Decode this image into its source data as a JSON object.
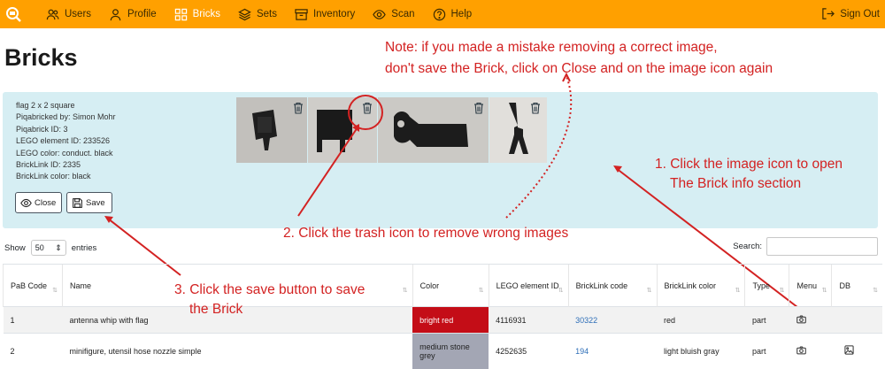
{
  "nav": {
    "items": [
      {
        "label": "Users",
        "icon": "users-icon"
      },
      {
        "label": "Profile",
        "icon": "person-icon"
      },
      {
        "label": "Bricks",
        "icon": "grid-icon"
      },
      {
        "label": "Sets",
        "icon": "layers-icon"
      },
      {
        "label": "Inventory",
        "icon": "archive-icon"
      },
      {
        "label": "Scan",
        "icon": "eye-icon"
      },
      {
        "label": "Help",
        "icon": "question-icon"
      }
    ],
    "active": "Bricks",
    "signout": "Sign Out"
  },
  "page": {
    "title": "Bricks"
  },
  "note": {
    "line1": "Note: if you made a mistake removing a correct image,",
    "line2": "don't save the Brick, click on Close and on the image icon again"
  },
  "info": {
    "lines": [
      "flag 2 x 2 square",
      "Piqabricked by: Simon Mohr",
      "Piqabrick ID: 3",
      "LEGO element ID: 233526",
      "LEGO color: conduct. black",
      "BrickLink ID: 2335",
      "BrickLink color: black"
    ],
    "close_label": "Close",
    "save_label": "Save"
  },
  "annotations": {
    "step1_line1": "1. Click the image icon to open",
    "step1_line2": "The Brick info section",
    "step2": "2. Click the trash icon to remove wrong images",
    "step3_line1": "3. Click the save button to save",
    "step3_line2": "the Brick"
  },
  "controls": {
    "show_label": "Show",
    "show_value": "50",
    "entries_label": "entries",
    "search_label": "Search:"
  },
  "table": {
    "headers": [
      "PaB Code",
      "Name",
      "Color",
      "LEGO element ID",
      "BrickLink code",
      "BrickLink color",
      "Type",
      "Menu",
      "DB"
    ],
    "rows": [
      {
        "code": "1",
        "name": "antenna whip with flag",
        "color": "bright red",
        "color_hex": "#c40d17",
        "element_id": "4116931",
        "bl_code": "30322",
        "bl_color": "red",
        "type": "part"
      },
      {
        "code": "2",
        "name": "minifigure, utensil hose nozzle simple",
        "color": "medium stone grey",
        "color_hex": "#a3a6b4",
        "element_id": "4252635",
        "bl_code": "194",
        "bl_color": "light bluish gray",
        "type": "part"
      }
    ]
  },
  "colors": {
    "nav_bg": "#ffa000",
    "panel_bg": "#d6eef3",
    "annotation": "#d32222"
  }
}
